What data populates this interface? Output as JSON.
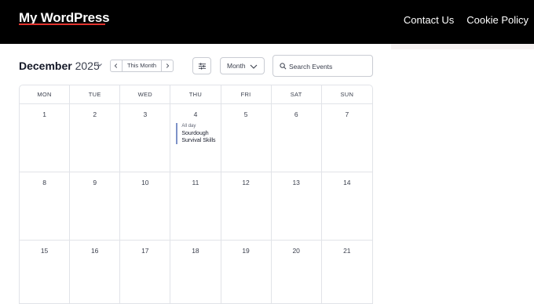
{
  "site": {
    "title": "My WordPress",
    "nav": [
      "Contact Us",
      "Cookie Policy"
    ],
    "accent_color": "#e3342f"
  },
  "toolbar": {
    "month": "December",
    "year": "2025",
    "this_month_label": "This Month",
    "prev_icon": "chevron-left-icon",
    "next_icon": "chevron-right-icon",
    "filter_icon": "sliders-icon",
    "view_select": "Month",
    "search_placeholder": "Search Events"
  },
  "calendar": {
    "weekdays": [
      "MON",
      "TUE",
      "WED",
      "THU",
      "FRI",
      "SAT",
      "SUN"
    ],
    "weeks": [
      [
        "1",
        "2",
        "3",
        "4",
        "5",
        "6",
        "7"
      ],
      [
        "8",
        "9",
        "10",
        "11",
        "12",
        "13",
        "14"
      ],
      [
        "15",
        "16",
        "17",
        "18",
        "19",
        "20",
        "21"
      ]
    ],
    "events": [
      {
        "day": "4",
        "time": "All day",
        "title": "Sourdough Survival Skills",
        "color": "#7e92c8"
      }
    ]
  }
}
